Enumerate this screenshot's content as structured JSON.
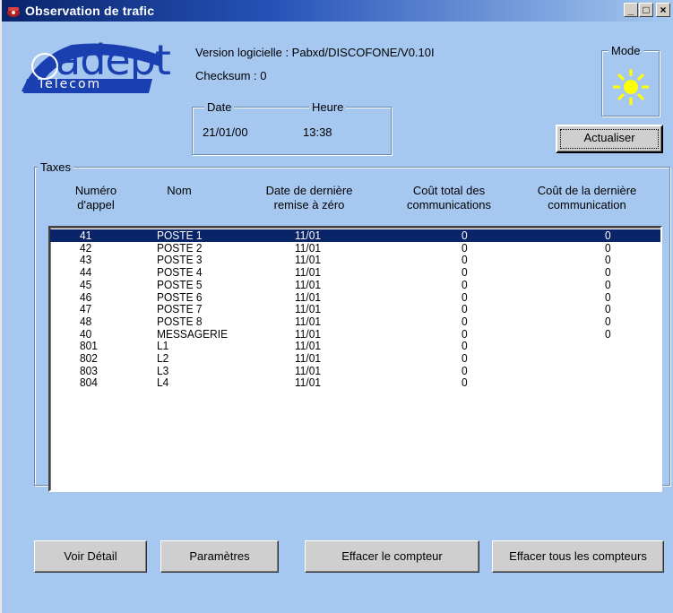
{
  "window": {
    "title": "Observation de trafic"
  },
  "logo": {
    "text": "adept",
    "subtext": "Telecom"
  },
  "info": {
    "version": "Version logicielle : Pabxd/DISCOFONE/V0.10I",
    "checksum": "Checksum : 0"
  },
  "datetime": {
    "date_label": "Date",
    "time_label": "Heure",
    "date": "21/01/00",
    "time": "13:38"
  },
  "mode": {
    "label": "Mode",
    "icon": "sun-icon",
    "color": "#ffff00"
  },
  "buttons": {
    "refresh": "Actualiser",
    "details": "Voir Détail",
    "settings": "Paramètres",
    "clear_counter": "Effacer le compteur",
    "clear_all": "Effacer tous les compteurs"
  },
  "taxes": {
    "label": "Taxes",
    "columns": {
      "number": [
        "Numéro",
        "d'appel"
      ],
      "name": [
        "Nom"
      ],
      "reset_date": [
        "Date de dernière",
        "remise à zéro"
      ],
      "total_cost": [
        "Coût total des",
        "communications"
      ],
      "last_cost": [
        "Coût de la dernière",
        "communication"
      ]
    },
    "rows": [
      {
        "number": "41",
        "name": "POSTE 1",
        "date": "11/01",
        "total": "0",
        "last": "0"
      },
      {
        "number": "42",
        "name": "POSTE 2",
        "date": "11/01",
        "total": "0",
        "last": "0"
      },
      {
        "number": "43",
        "name": "POSTE 3",
        "date": "11/01",
        "total": "0",
        "last": "0"
      },
      {
        "number": "44",
        "name": "POSTE 4",
        "date": "11/01",
        "total": "0",
        "last": "0"
      },
      {
        "number": "45",
        "name": "POSTE 5",
        "date": "11/01",
        "total": "0",
        "last": "0"
      },
      {
        "number": "46",
        "name": "POSTE 6",
        "date": "11/01",
        "total": "0",
        "last": "0"
      },
      {
        "number": "47",
        "name": "POSTE 7",
        "date": "11/01",
        "total": "0",
        "last": "0"
      },
      {
        "number": "48",
        "name": "POSTE 8",
        "date": "11/01",
        "total": "0",
        "last": "0"
      },
      {
        "number": "40",
        "name": "MESSAGERIE",
        "date": "11/01",
        "total": "0",
        "last": "0"
      },
      {
        "number": "801",
        "name": "L1",
        "date": "11/01",
        "total": "0",
        "last": ""
      },
      {
        "number": "802",
        "name": "L2",
        "date": "11/01",
        "total": "0",
        "last": ""
      },
      {
        "number": "803",
        "name": "L3",
        "date": "11/01",
        "total": "0",
        "last": ""
      },
      {
        "number": "804",
        "name": "L4",
        "date": "11/01",
        "total": "0",
        "last": ""
      }
    ],
    "selected_index": 0
  }
}
